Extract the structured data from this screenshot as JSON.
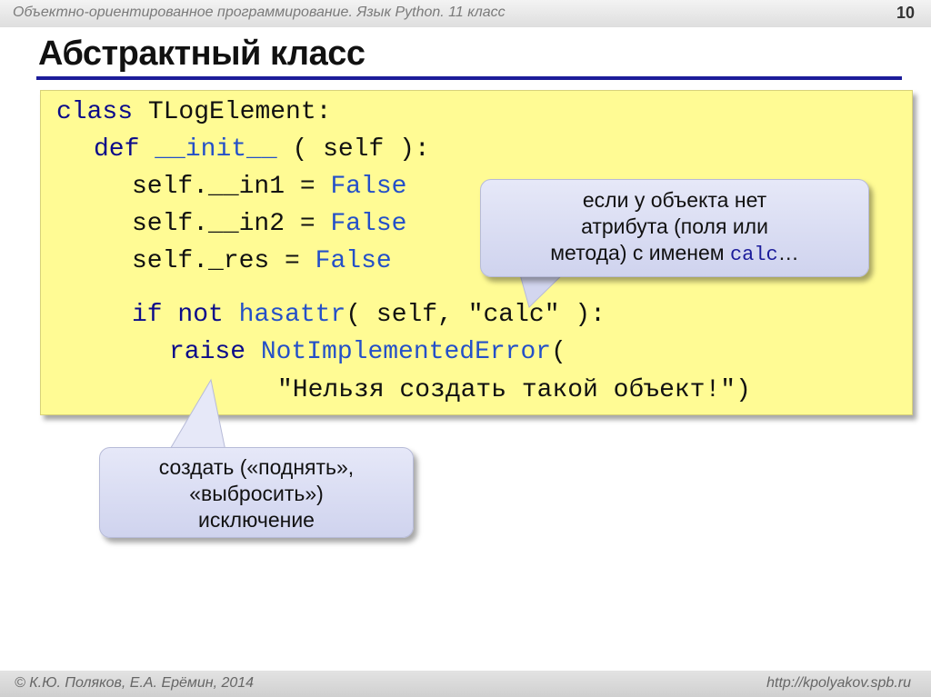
{
  "header": {
    "course": "Объектно-ориентированное программирование. Язык Python. 11 класс",
    "slide_number": "10"
  },
  "slide": {
    "title": "Абстрактный класс"
  },
  "code": {
    "l1_kw": "class",
    "l1_rest": " TLogElement:",
    "l2_kw": "def",
    "l2_func": "__init__",
    "l2_rest": "( self ):",
    "l3_a": "self.__in1",
    "l3_eq": " = ",
    "l3_val": "False",
    "l4_a": "self.__in2",
    "l4_eq": " = ",
    "l4_val": "False",
    "l5_a": "self._res",
    "l5_eq": " = ",
    "l5_val": "False",
    "l6_kw1": "if",
    "l6_kw2": "not",
    "l6_fn": "hasattr",
    "l6_rest1": "( self, ",
    "l6_str": "\"calc\"",
    "l6_rest2": " ):",
    "l7_kw": "raise",
    "l7_exc": "NotImplementedError",
    "l7_paren": "(",
    "l8_str": "\"Нельзя создать такой объект!\"",
    "l8_close": ")"
  },
  "callouts": {
    "top_line1": "если у объекта нет",
    "top_line2": "атрибута (поля или",
    "top_line3_pre": "метода) с именем ",
    "top_line3_code": "calc",
    "top_line3_post": "…",
    "bottom_line1": "создать («поднять»,",
    "bottom_line2": "«выбросить»)",
    "bottom_line3": "исключение"
  },
  "footer": {
    "left": "© К.Ю. Поляков, Е.А. Ерёмин, 2014",
    "right": "http://kpolyakov.spb.ru"
  }
}
